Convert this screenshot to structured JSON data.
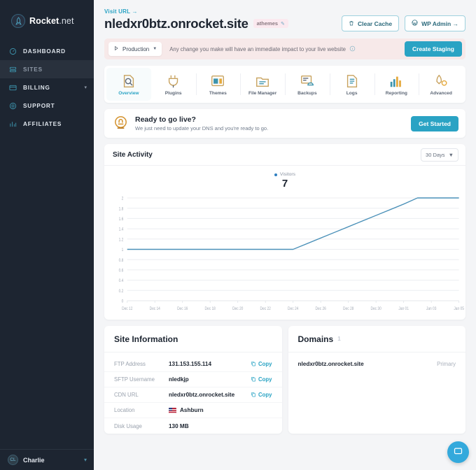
{
  "sidebar": {
    "brand": {
      "name_bold": "Rocket",
      "name_light": ".net",
      "logo_icon": "rocket-logo-icon"
    },
    "items": [
      {
        "label": "DASHBOARD",
        "icon": "gauge-icon",
        "active": false,
        "chevron": false
      },
      {
        "label": "SITES",
        "icon": "server-icon",
        "active": true,
        "chevron": false
      },
      {
        "label": "BILLING",
        "icon": "credit-card-icon",
        "active": false,
        "chevron": true
      },
      {
        "label": "SUPPORT",
        "icon": "lifebuoy-icon",
        "active": false,
        "chevron": false
      },
      {
        "label": "AFFILIATES",
        "icon": "bar-chart-icon",
        "active": false,
        "chevron": false
      }
    ],
    "footer": {
      "username": "Charlie",
      "avatar_initials": "CL",
      "chevron_icon": "chevron-down-icon"
    }
  },
  "header": {
    "visit_url_label": "Visit URL →",
    "site_title": "nledxr0btz.onrocket.site",
    "tag_label": "athemes",
    "tag_edit_icon": "pencil-icon",
    "clear_cache_label": "Clear Cache",
    "clear_cache_icon": "trash-icon",
    "wp_admin_label": "WP Admin →",
    "wp_admin_icon": "wordpress-icon"
  },
  "environment_bar": {
    "env_label": "Production",
    "env_icon": "play-icon",
    "env_chevron": "chevron-down-icon",
    "notice": "Any change you make will have an immediate impact to your live website",
    "info_icon": "info-icon",
    "create_staging_label": "Create Staging"
  },
  "tabs": [
    {
      "label": "Overview",
      "icon": "magnify-document-icon",
      "active": true
    },
    {
      "label": "Plugins",
      "icon": "plug-icon",
      "active": false
    },
    {
      "label": "Themes",
      "icon": "layout-icon",
      "active": false
    },
    {
      "label": "File Manager",
      "icon": "folder-icon",
      "active": false
    },
    {
      "label": "Backups",
      "icon": "cloud-backup-icon",
      "active": false
    },
    {
      "label": "Logs",
      "icon": "document-lines-icon",
      "active": false
    },
    {
      "label": "Reporting",
      "icon": "bar-chart-icon",
      "active": false
    },
    {
      "label": "Advanced",
      "icon": "rocket-gear-icon",
      "active": false
    }
  ],
  "go_live_banner": {
    "icon": "bell-badge-icon",
    "title": "Ready to go live?",
    "subtitle": "We just need to update your DNS and you're ready to go.",
    "button_label": "Get Started"
  },
  "site_activity": {
    "title": "Site Activity",
    "range_label": "30 Days",
    "range_chevron": "chevron-down-icon",
    "legend_label": "Visitors",
    "legend_color": "#2f7fc1",
    "total_value": "7"
  },
  "chart_data": {
    "type": "line",
    "title": "Site Activity",
    "xlabel": "",
    "ylabel": "",
    "ylim": [
      0,
      2
    ],
    "yticks": [
      "0",
      "0.2",
      "0.4",
      "0.6",
      "0.8",
      "1",
      "1.2",
      "1.4",
      "1.6",
      "1.8",
      "2"
    ],
    "grid": true,
    "legend_position": "top-center",
    "line_color": "#4a90b8",
    "categories": [
      "Dec 12",
      "Dec 13",
      "Dec 14",
      "Dec 15",
      "Dec 16",
      "Dec 17",
      "Dec 18",
      "Dec 19",
      "Dec 20",
      "Dec 21",
      "Dec 22",
      "Dec 23",
      "Dec 24",
      "Dec 25",
      "Dec 26",
      "Dec 27",
      "Dec 28",
      "Dec 29",
      "Dec 30",
      "Dec 31",
      "Jan 01",
      "Jan 02",
      "Jan 03",
      "Jan 04",
      "Jan 05"
    ],
    "tick_labels": [
      "Dec 12",
      "Dec 14",
      "Dec 16",
      "Dec 18",
      "Dec 20",
      "Dec 22",
      "Dec 24",
      "Dec 26",
      "Dec 28",
      "Dec 30",
      "Jan 01",
      "Jan 03",
      "Jan 05"
    ],
    "series": [
      {
        "name": "Visitors",
        "values": [
          1,
          1,
          1,
          1,
          1,
          1,
          1,
          1,
          1,
          1,
          1,
          1,
          1,
          1.11,
          1.22,
          1.33,
          1.44,
          1.55,
          1.66,
          1.77,
          1.88,
          2,
          2,
          2,
          2
        ]
      }
    ]
  },
  "site_information": {
    "title": "Site Information",
    "copy_label": "Copy",
    "copy_icon": "copy-icon",
    "rows": [
      {
        "label": "FTP Address",
        "value": "131.153.155.114",
        "copy": true,
        "flag": false
      },
      {
        "label": "SFTP Username",
        "value": "nledkjp",
        "copy": true,
        "flag": false
      },
      {
        "label": "CDN URL",
        "value": "nledxr0btz.onrocket.site",
        "copy": true,
        "flag": false
      },
      {
        "label": "Location",
        "value": "Ashburn",
        "copy": false,
        "flag": true
      },
      {
        "label": "Disk Usage",
        "value": "130 MB",
        "copy": false,
        "flag": false
      }
    ]
  },
  "domains": {
    "title": "Domains",
    "count": "1",
    "rows": [
      {
        "name": "nledxr0btz.onrocket.site",
        "tag": "Primary"
      }
    ]
  },
  "chat_widget": {
    "icon": "chat-bubble-icon"
  },
  "colors": {
    "accent": "#2aa3c4",
    "sidebar": "#1d2531",
    "line": "#4a90b8",
    "notice_bg": "#f7e9e9"
  }
}
